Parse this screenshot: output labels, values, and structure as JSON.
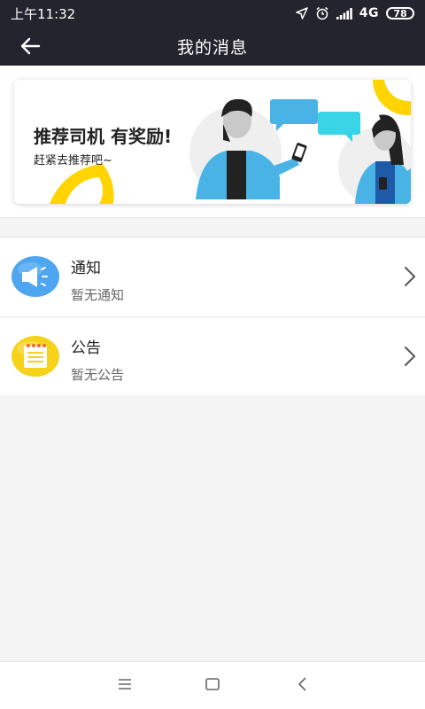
{
  "status_bar": {
    "time": "上午11:32",
    "network": "4G",
    "battery": "78",
    "icons": [
      "location-icon",
      "alarm-icon",
      "signal-icon",
      "battery-icon"
    ]
  },
  "header": {
    "title": "我的消息",
    "back_icon": "back-arrow-icon"
  },
  "banner": {
    "heading": "推荐司机  有奖励!",
    "subtitle": "赶紧去推荐吧~"
  },
  "messages": [
    {
      "title": "通知",
      "subtitle": "暂无通知",
      "icon": "megaphone-icon",
      "color": "#4ea6f0"
    },
    {
      "title": "公告",
      "subtitle": "暂无公告",
      "icon": "notepad-icon",
      "color": "#f7d21a"
    }
  ],
  "nav_bar": {
    "icons": [
      "menu-icon",
      "home-icon",
      "back-icon"
    ]
  },
  "colors": {
    "header_bg": "#22252d",
    "accent_yellow": "#ffd400",
    "accent_blue": "#4ab3e6"
  }
}
